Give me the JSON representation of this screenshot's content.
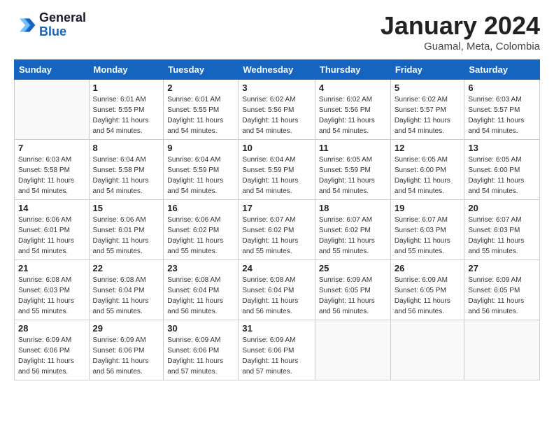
{
  "header": {
    "logo_line1": "General",
    "logo_line2": "Blue",
    "month": "January 2024",
    "location": "Guamal, Meta, Colombia"
  },
  "days_of_week": [
    "Sunday",
    "Monday",
    "Tuesday",
    "Wednesday",
    "Thursday",
    "Friday",
    "Saturday"
  ],
  "weeks": [
    [
      {
        "day": "",
        "sunrise": "",
        "sunset": "",
        "daylight": ""
      },
      {
        "day": "1",
        "sunrise": "6:01 AM",
        "sunset": "5:55 PM",
        "daylight": "11 hours and 54 minutes."
      },
      {
        "day": "2",
        "sunrise": "6:01 AM",
        "sunset": "5:55 PM",
        "daylight": "11 hours and 54 minutes."
      },
      {
        "day": "3",
        "sunrise": "6:02 AM",
        "sunset": "5:56 PM",
        "daylight": "11 hours and 54 minutes."
      },
      {
        "day": "4",
        "sunrise": "6:02 AM",
        "sunset": "5:56 PM",
        "daylight": "11 hours and 54 minutes."
      },
      {
        "day": "5",
        "sunrise": "6:02 AM",
        "sunset": "5:57 PM",
        "daylight": "11 hours and 54 minutes."
      },
      {
        "day": "6",
        "sunrise": "6:03 AM",
        "sunset": "5:57 PM",
        "daylight": "11 hours and 54 minutes."
      }
    ],
    [
      {
        "day": "7",
        "sunrise": "6:03 AM",
        "sunset": "5:58 PM",
        "daylight": "11 hours and 54 minutes."
      },
      {
        "day": "8",
        "sunrise": "6:04 AM",
        "sunset": "5:58 PM",
        "daylight": "11 hours and 54 minutes."
      },
      {
        "day": "9",
        "sunrise": "6:04 AM",
        "sunset": "5:59 PM",
        "daylight": "11 hours and 54 minutes."
      },
      {
        "day": "10",
        "sunrise": "6:04 AM",
        "sunset": "5:59 PM",
        "daylight": "11 hours and 54 minutes."
      },
      {
        "day": "11",
        "sunrise": "6:05 AM",
        "sunset": "5:59 PM",
        "daylight": "11 hours and 54 minutes."
      },
      {
        "day": "12",
        "sunrise": "6:05 AM",
        "sunset": "6:00 PM",
        "daylight": "11 hours and 54 minutes."
      },
      {
        "day": "13",
        "sunrise": "6:05 AM",
        "sunset": "6:00 PM",
        "daylight": "11 hours and 54 minutes."
      }
    ],
    [
      {
        "day": "14",
        "sunrise": "6:06 AM",
        "sunset": "6:01 PM",
        "daylight": "11 hours and 54 minutes."
      },
      {
        "day": "15",
        "sunrise": "6:06 AM",
        "sunset": "6:01 PM",
        "daylight": "11 hours and 55 minutes."
      },
      {
        "day": "16",
        "sunrise": "6:06 AM",
        "sunset": "6:02 PM",
        "daylight": "11 hours and 55 minutes."
      },
      {
        "day": "17",
        "sunrise": "6:07 AM",
        "sunset": "6:02 PM",
        "daylight": "11 hours and 55 minutes."
      },
      {
        "day": "18",
        "sunrise": "6:07 AM",
        "sunset": "6:02 PM",
        "daylight": "11 hours and 55 minutes."
      },
      {
        "day": "19",
        "sunrise": "6:07 AM",
        "sunset": "6:03 PM",
        "daylight": "11 hours and 55 minutes."
      },
      {
        "day": "20",
        "sunrise": "6:07 AM",
        "sunset": "6:03 PM",
        "daylight": "11 hours and 55 minutes."
      }
    ],
    [
      {
        "day": "21",
        "sunrise": "6:08 AM",
        "sunset": "6:03 PM",
        "daylight": "11 hours and 55 minutes."
      },
      {
        "day": "22",
        "sunrise": "6:08 AM",
        "sunset": "6:04 PM",
        "daylight": "11 hours and 55 minutes."
      },
      {
        "day": "23",
        "sunrise": "6:08 AM",
        "sunset": "6:04 PM",
        "daylight": "11 hours and 56 minutes."
      },
      {
        "day": "24",
        "sunrise": "6:08 AM",
        "sunset": "6:04 PM",
        "daylight": "11 hours and 56 minutes."
      },
      {
        "day": "25",
        "sunrise": "6:09 AM",
        "sunset": "6:05 PM",
        "daylight": "11 hours and 56 minutes."
      },
      {
        "day": "26",
        "sunrise": "6:09 AM",
        "sunset": "6:05 PM",
        "daylight": "11 hours and 56 minutes."
      },
      {
        "day": "27",
        "sunrise": "6:09 AM",
        "sunset": "6:05 PM",
        "daylight": "11 hours and 56 minutes."
      }
    ],
    [
      {
        "day": "28",
        "sunrise": "6:09 AM",
        "sunset": "6:06 PM",
        "daylight": "11 hours and 56 minutes."
      },
      {
        "day": "29",
        "sunrise": "6:09 AM",
        "sunset": "6:06 PM",
        "daylight": "11 hours and 56 minutes."
      },
      {
        "day": "30",
        "sunrise": "6:09 AM",
        "sunset": "6:06 PM",
        "daylight": "11 hours and 57 minutes."
      },
      {
        "day": "31",
        "sunrise": "6:09 AM",
        "sunset": "6:06 PM",
        "daylight": "11 hours and 57 minutes."
      },
      {
        "day": "",
        "sunrise": "",
        "sunset": "",
        "daylight": ""
      },
      {
        "day": "",
        "sunrise": "",
        "sunset": "",
        "daylight": ""
      },
      {
        "day": "",
        "sunrise": "",
        "sunset": "",
        "daylight": ""
      }
    ]
  ]
}
